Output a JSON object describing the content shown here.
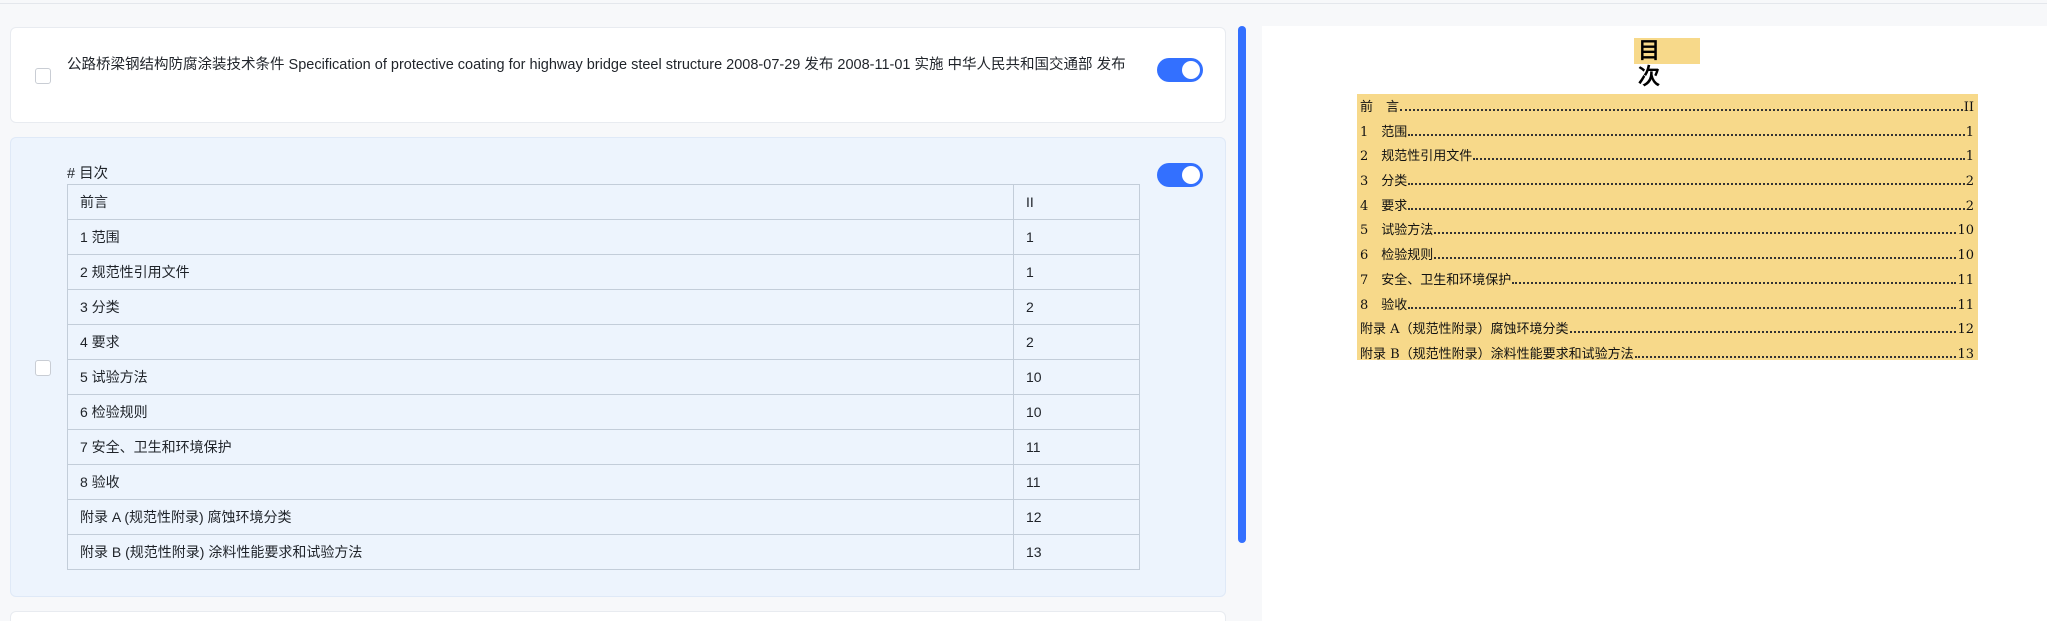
{
  "card1": {
    "text": "公路桥梁钢结构防腐涂装技术条件 Specification of protective coating for highway bridge steel structure 2008-07-29 发布 2008-11-01 实施 中华人民共和国交通部 发布"
  },
  "card2": {
    "heading": "# 目次",
    "rows": [
      {
        "title": "前言",
        "page": "II"
      },
      {
        "title": "1 范围",
        "page": "1"
      },
      {
        "title": "2 规范性引用文件",
        "page": "1"
      },
      {
        "title": "3 分类",
        "page": "2"
      },
      {
        "title": "4 要求",
        "page": "2"
      },
      {
        "title": "5 试验方法",
        "page": "10"
      },
      {
        "title": "6 检验规则",
        "page": "10"
      },
      {
        "title": "7 安全、卫生和环境保护",
        "page": "11"
      },
      {
        "title": "8 验收",
        "page": "11"
      },
      {
        "title": "附录 A (规范性附录) 腐蚀环境分类",
        "page": "12"
      },
      {
        "title": "附录 B (规范性附录) 涂料性能要求和试验方法",
        "page": "13"
      }
    ]
  },
  "document": {
    "title": "目 次",
    "lines": [
      {
        "label": "前　言",
        "page": "II"
      },
      {
        "label": "1　范围",
        "page": "1"
      },
      {
        "label": "2　规范性引用文件",
        "page": "1"
      },
      {
        "label": "3　分类",
        "page": "2"
      },
      {
        "label": "4　要求",
        "page": "2"
      },
      {
        "label": "5　试验方法",
        "page": "10"
      },
      {
        "label": "6　检验规则",
        "page": "10"
      },
      {
        "label": "7　安全、卫生和环境保护",
        "page": "11"
      },
      {
        "label": "8　验收",
        "page": "11"
      },
      {
        "label": "附录 A（规范性附录）腐蚀环境分类",
        "page": "12"
      },
      {
        "label": "附录 B（规范性附录）涂料性能要求和试验方法",
        "page": "13"
      }
    ]
  },
  "colors": {
    "accent": "#3370ff",
    "selected_card": "#edf4fd",
    "highlight": "#f7d98a"
  },
  "icons": {
    "toggle": "toggle-switch-on",
    "checkbox": "checkbox-unchecked"
  }
}
